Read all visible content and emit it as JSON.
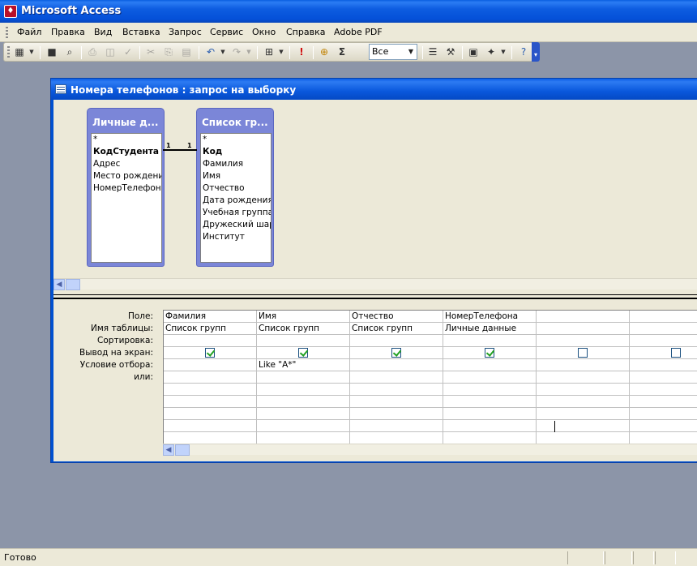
{
  "app": {
    "title": "Microsoft Access"
  },
  "menu": {
    "items": [
      "Файл",
      "Правка",
      "Вид",
      "Вставка",
      "Запрос",
      "Сервис",
      "Окно",
      "Справка",
      "Adobe PDF"
    ]
  },
  "toolbar": {
    "top_values": "Все"
  },
  "query_window": {
    "title": "Номера телефонов : запрос на выборку",
    "relationship": {
      "left_end": "1",
      "right_end": "1"
    },
    "tables": [
      {
        "name": "Личные д...",
        "fields": [
          "*",
          "КодСтудента",
          "Адрес",
          "Место рождения",
          "НомерТелефона"
        ],
        "key_field": 1
      },
      {
        "name": "Список гр...",
        "fields": [
          "*",
          "Код",
          "Фамилия",
          "Имя",
          "Отчество",
          "Дата рождения",
          "Учебная группа",
          "Дружеский шарж",
          "Институт"
        ],
        "key_field": 1
      }
    ],
    "grid": {
      "row_labels": [
        "Поле:",
        "Имя таблицы:",
        "Сортировка:",
        "Вывод на экран:",
        "Условие отбора:",
        "или:"
      ],
      "columns": [
        {
          "field": "Фамилия",
          "table": "Список групп",
          "sort": "",
          "show": true,
          "criteria": "",
          "or": ""
        },
        {
          "field": "Имя",
          "table": "Список групп",
          "sort": "",
          "show": true,
          "criteria": "Like \"А*\"",
          "or": ""
        },
        {
          "field": "Отчество",
          "table": "Список групп",
          "sort": "",
          "show": true,
          "criteria": "",
          "or": ""
        },
        {
          "field": "НомерТелефона",
          "table": "Личные данные",
          "sort": "",
          "show": true,
          "criteria": "",
          "or": ""
        },
        {
          "field": "",
          "table": "",
          "sort": "",
          "show": false,
          "criteria": "",
          "or": ""
        },
        {
          "field": "",
          "table": "",
          "sort": "",
          "show": false,
          "criteria": "",
          "or": ""
        }
      ]
    }
  },
  "status": {
    "text": "Готово"
  }
}
